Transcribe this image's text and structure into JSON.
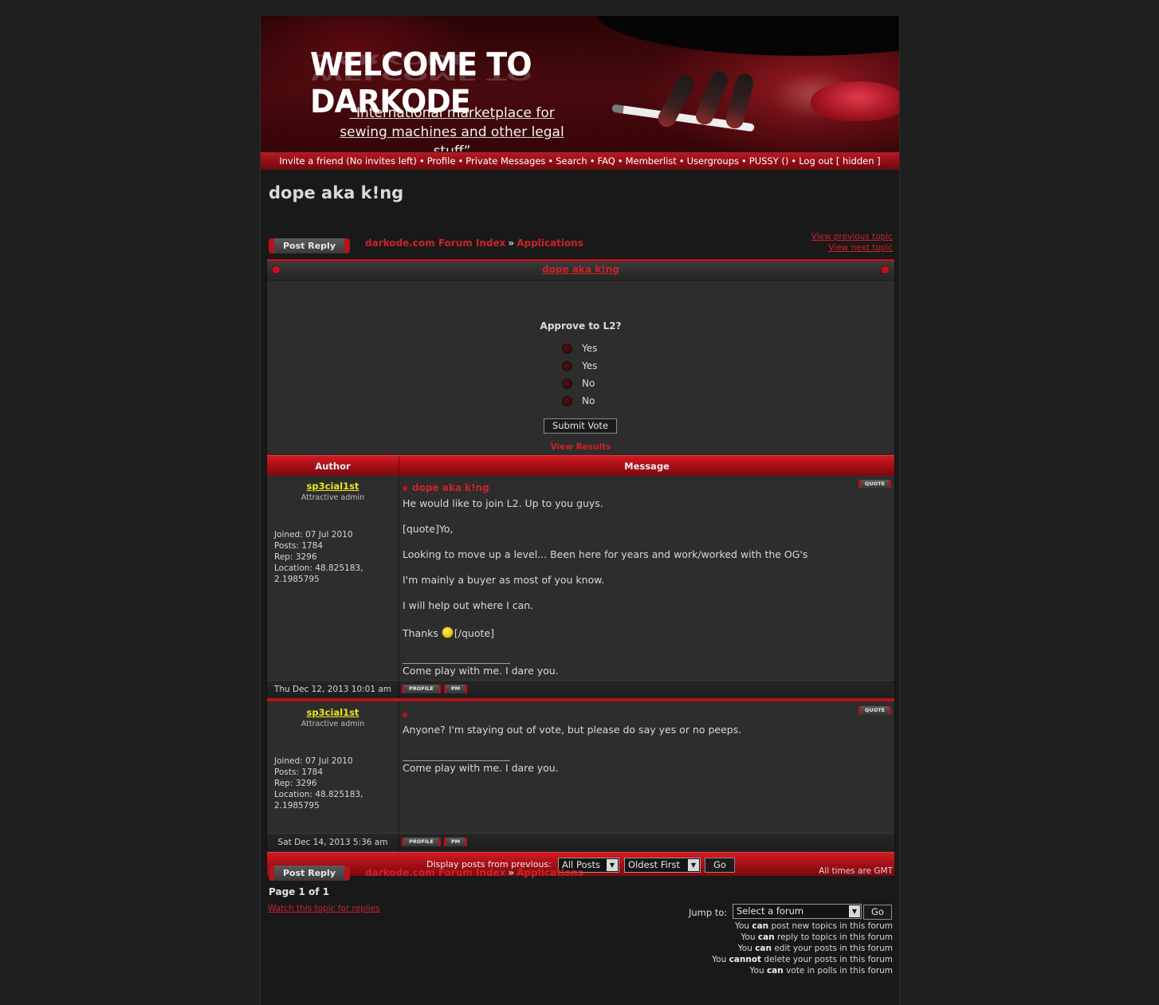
{
  "banner": {
    "title": "WELCOME TO DARKODE",
    "tagline_1": "“International marketplace for",
    "tagline_2": "sewing machines and other legal stuff”"
  },
  "nav": {
    "invite": "Invite a friend (No invites left)",
    "profile": "Profile",
    "private_messages": "Private Messages",
    "search": "Search",
    "faq": "FAQ",
    "memberlist": "Memberlist",
    "usergroups": "Usergroups",
    "pussy": "PUSSY ()",
    "logout": "Log out [ hidden ]",
    "separator": "•"
  },
  "topic": {
    "title": "dope aka k!ng",
    "post_reply": "Post Reply",
    "forum_index": "darkode.com Forum Index",
    "raquo": "»",
    "forum": "Applications",
    "view_previous": "View previous topic",
    "view_next": "View next topic"
  },
  "poll": {
    "title": "dope aka k!ng",
    "question": "Approve to L2?",
    "options": [
      "Yes",
      "Yes",
      "No",
      "No"
    ],
    "submit": "Submit Vote",
    "view_results": "View Results"
  },
  "table": {
    "author_header": "Author",
    "message_header": "Message",
    "quote_label": "QUOTE",
    "profile_label": "PROFILE",
    "pm_label": "PM"
  },
  "posts": [
    {
      "author": "sp3cial1st",
      "rank": "Attractive admin",
      "joined": "Joined: 07 Jul 2010",
      "posts": "Posts: 1784",
      "rep": "Rep: 3296",
      "location_1": "Location: 48.825183,",
      "location_2": "2.1985795",
      "subject": "dope aka k!ng",
      "lines": [
        "He would like to join L2. Up to you guys.",
        "[quote]Yo,",
        "Looking to move up a level... Been here for years and work/worked with the OG's",
        "I'm mainly a buyer as most of you know.",
        "I will help out where I can.",
        "Thanks",
        "[/quote]"
      ],
      "signature": "Come play with me. I dare you.",
      "date": "Thu Dec 12, 2013 10:01 am"
    },
    {
      "author": "sp3cial1st",
      "rank": "Attractive admin",
      "joined": "Joined: 07 Jul 2010",
      "posts": "Posts: 1784",
      "rep": "Rep: 3296",
      "location_1": "Location: 48.825183,",
      "location_2": "2.1985795",
      "subject": "",
      "lines": [
        "Anyone? I'm staying out of vote, but please do say yes or no peeps."
      ],
      "signature": "Come play with me. I dare you.",
      "date": "Sat Dec 14, 2013 5:36 am"
    }
  ],
  "display": {
    "label": "Display posts from previous:",
    "range": "All Posts",
    "order": "Oldest First",
    "go": "Go"
  },
  "footer": {
    "times": "All times are GMT",
    "page": "Page 1 of 1",
    "watch": "Watch this topic for replies",
    "jump_label": "Jump to:",
    "jump_select": "Select a forum",
    "jump_go": "Go",
    "permissions": [
      {
        "pre": "You ",
        "bold": "can",
        "post": " post new topics in this forum"
      },
      {
        "pre": "You ",
        "bold": "can",
        "post": " reply to topics in this forum"
      },
      {
        "pre": "You ",
        "bold": "can",
        "post": " edit your posts in this forum"
      },
      {
        "pre": "You ",
        "bold": "cannot",
        "post": " delete your posts in this forum"
      },
      {
        "pre": "You ",
        "bold": "can",
        "post": " vote in polls in this forum"
      }
    ]
  }
}
